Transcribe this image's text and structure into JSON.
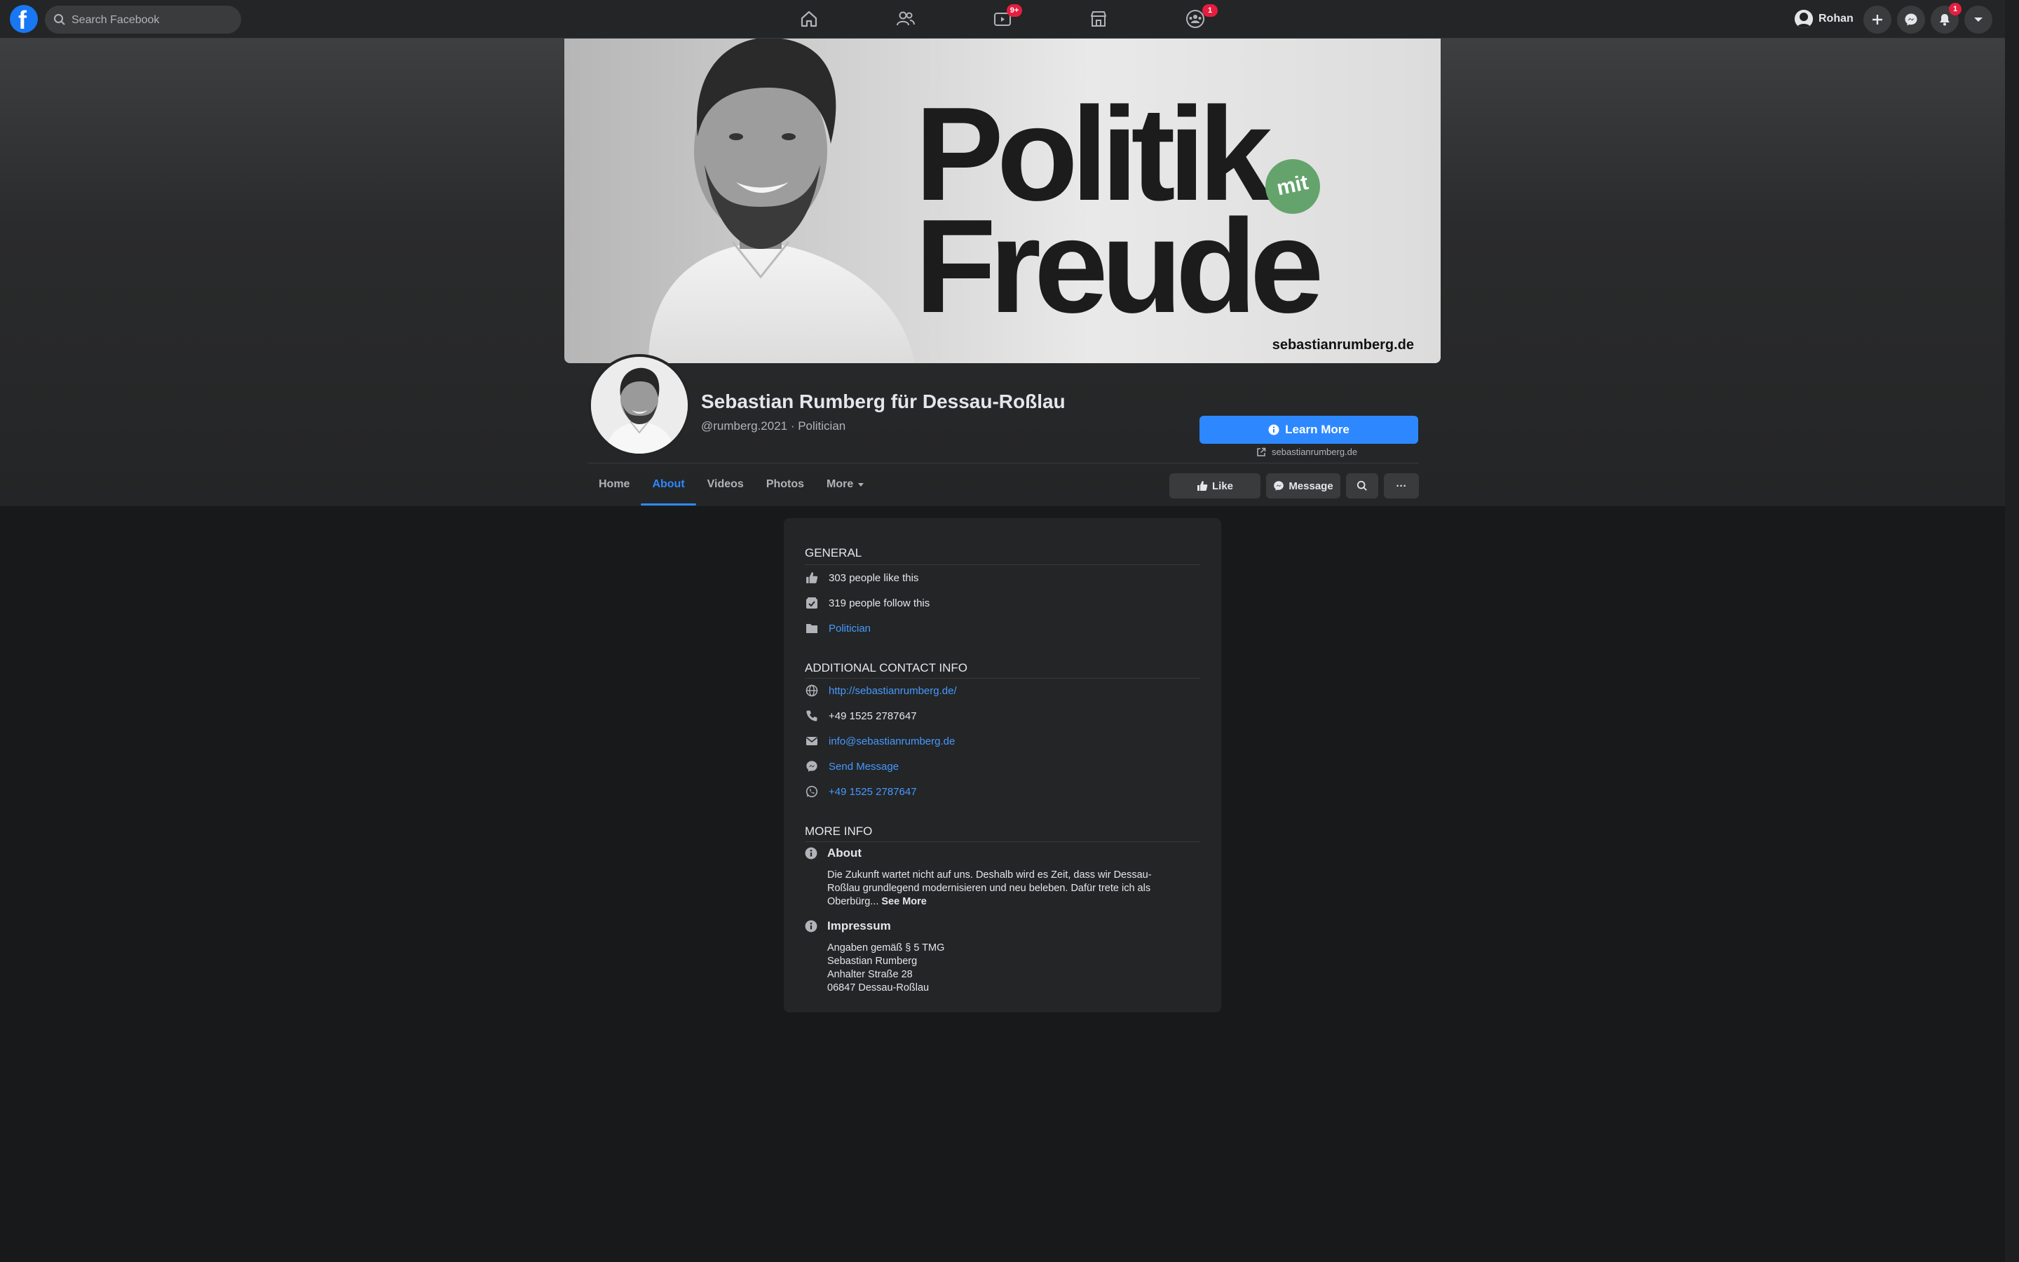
{
  "topbar": {
    "logo_letter": "f",
    "search_placeholder": "Search Facebook",
    "nav": [
      {
        "name": "home",
        "badge": ""
      },
      {
        "name": "friends",
        "badge": ""
      },
      {
        "name": "watch",
        "badge": "9+"
      },
      {
        "name": "marketplace",
        "badge": ""
      },
      {
        "name": "groups",
        "badge": "1"
      }
    ],
    "user_name": "Rohan",
    "notifications_badge": "1"
  },
  "cover": {
    "headline_line1": "Politik",
    "headline_word_small": "mit",
    "headline_line2": "Freude",
    "url": "sebastianrumberg.de"
  },
  "page": {
    "title": "Sebastian Rumberg für Dessau-Roßlau",
    "subtitle": "@rumberg.2021 · Politician",
    "cta_label": "Learn More",
    "cta_link": "sebastianrumberg.de"
  },
  "tabs": [
    {
      "label": "Home",
      "active": false
    },
    {
      "label": "About",
      "active": true
    },
    {
      "label": "Videos",
      "active": false
    },
    {
      "label": "Photos",
      "active": false
    },
    {
      "label": "More",
      "active": false
    }
  ],
  "actions": {
    "like": "Like",
    "message": "Message",
    "more": "···"
  },
  "about": {
    "general_title": "GENERAL",
    "likes": "303 people like this",
    "follows": "319 people follow this",
    "category": "Politician",
    "contact_title": "ADDITIONAL CONTACT INFO",
    "website": "http://sebastianrumberg.de/",
    "phone": "+49 1525 2787647",
    "email": "info@sebastianrumberg.de",
    "send_message": "Send Message",
    "whatsapp": "+49 1525 2787647",
    "more_title": "MORE INFO",
    "about_label": "About",
    "about_text": "Die Zukunft wartet nicht auf uns. Deshalb wird es Zeit, dass wir Dessau-Roßlau grundlegend modernisieren und neu beleben. Dafür trete ich als Oberbürg...",
    "see_more": "See More",
    "impressum_label": "Impressum",
    "impressum_lines": [
      "Angaben gemäß § 5 TMG",
      "Sebastian Rumberg",
      "Anhalter Straße 28",
      "06847 Dessau-Roßlau"
    ]
  },
  "colors": {
    "accent": "#2d88ff",
    "link": "#4599ff",
    "background": "#18191a",
    "surface": "#242526",
    "badge": "#e41e3f"
  }
}
